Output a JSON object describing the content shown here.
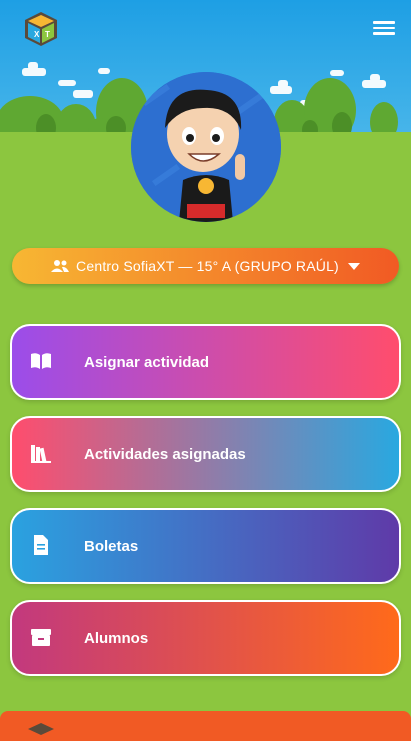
{
  "header": {
    "logo_icon": "sofiaxt-cube-logo-icon",
    "menu_icon": "hamburger-menu-icon"
  },
  "avatar": {
    "icon": "cartoon-boy-avatar"
  },
  "group_selector": {
    "label": "Centro SofiaXT — 15° A (GRUPO RAÚL)",
    "icon": "users-icon",
    "caret_icon": "caret-down-icon"
  },
  "menu": [
    {
      "label": "Asignar actividad",
      "icon": "book-open-icon"
    },
    {
      "label": "Actividades asignadas",
      "icon": "books-icon"
    },
    {
      "label": "Boletas",
      "icon": "file-document-icon"
    },
    {
      "label": "Alumnos",
      "icon": "inbox-box-icon"
    }
  ],
  "colors": {
    "sky": "#29a8e0",
    "grass": "#8cc63f",
    "accent": "#f15a24"
  }
}
